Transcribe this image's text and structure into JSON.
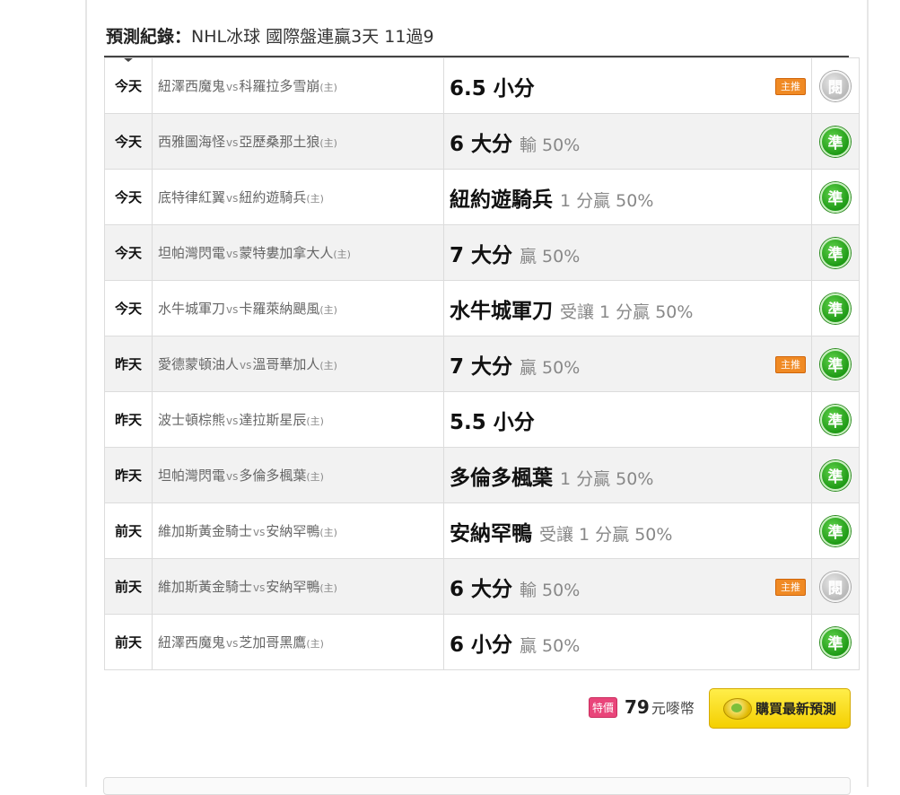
{
  "header": {
    "label": "預測紀錄：",
    "text": "NHL冰球 國際盤連贏3天 11過9"
  },
  "icons": {
    "result_win": "check-correct-icon",
    "result_none": "unevaluated-icon",
    "main_pick": "main-pick-badge",
    "coin": "coin-icon"
  },
  "colors": {
    "win_green": "#1f9a16",
    "none_gray": "#b9b9b9",
    "badge_orange": "#f08a24",
    "button_yellow": "#f4cf00",
    "sale_pink": "#e9457a"
  },
  "rows": [
    {
      "day": "今天",
      "away": "紐澤西魔鬼",
      "vs": "vs",
      "home": "科羅拉多雪崩",
      "home_tag": "(主)",
      "pick": "6.5 小分",
      "detail": "",
      "main_badge": "主推",
      "result": "閱",
      "result_type": "none"
    },
    {
      "day": "今天",
      "away": "西雅圖海怪",
      "vs": "vs",
      "home": "亞歷桑那土狼",
      "home_tag": "(主)",
      "pick": "6 大分",
      "detail": "輸 50%",
      "main_badge": "",
      "result": "準",
      "result_type": "win"
    },
    {
      "day": "今天",
      "away": "底特律紅翼",
      "vs": "vs",
      "home": "紐約遊騎兵",
      "home_tag": "(主)",
      "pick": "紐約遊騎兵",
      "detail": "1 分贏 50%",
      "main_badge": "",
      "result": "準",
      "result_type": "win"
    },
    {
      "day": "今天",
      "away": "坦帕灣閃電",
      "vs": "vs",
      "home": "蒙特婁加拿大人",
      "home_tag": "(主)",
      "pick": "7 大分",
      "detail": "贏 50%",
      "main_badge": "",
      "result": "準",
      "result_type": "win"
    },
    {
      "day": "今天",
      "away": "水牛城軍刀",
      "vs": "vs",
      "home": "卡羅萊納颶風",
      "home_tag": "(主)",
      "pick": "水牛城軍刀",
      "detail": "受讓 1 分贏 50%",
      "main_badge": "",
      "result": "準",
      "result_type": "win"
    },
    {
      "day": "昨天",
      "away": "愛德蒙頓油人",
      "vs": "vs",
      "home": "溫哥華加人",
      "home_tag": "(主)",
      "pick": "7 大分",
      "detail": "贏 50%",
      "main_badge": "主推",
      "result": "準",
      "result_type": "win"
    },
    {
      "day": "昨天",
      "away": "波士頓棕熊",
      "vs": "vs",
      "home": "達拉斯星辰",
      "home_tag": "(主)",
      "pick": "5.5 小分",
      "detail": "",
      "main_badge": "",
      "result": "準",
      "result_type": "win"
    },
    {
      "day": "昨天",
      "away": "坦帕灣閃電",
      "vs": "vs",
      "home": "多倫多楓葉",
      "home_tag": "(主)",
      "pick": "多倫多楓葉",
      "detail": "1 分贏 50%",
      "main_badge": "",
      "result": "準",
      "result_type": "win"
    },
    {
      "day": "前天",
      "away": "維加斯黃金騎士",
      "vs": "vs",
      "home": "安納罕鴨",
      "home_tag": "(主)",
      "pick": "安納罕鴨",
      "detail": "受讓 1 分贏 50%",
      "main_badge": "",
      "result": "準",
      "result_type": "win"
    },
    {
      "day": "前天",
      "away": "維加斯黃金騎士",
      "vs": "vs",
      "home": "安納罕鴨",
      "home_tag": "(主)",
      "pick": "6 大分",
      "detail": "輸 50%",
      "main_badge": "主推",
      "result": "閱",
      "result_type": "none"
    },
    {
      "day": "前天",
      "away": "紐澤西魔鬼",
      "vs": "vs",
      "home": "芝加哥黑鷹",
      "home_tag": "(主)",
      "pick": "6 小分",
      "detail": "贏 50%",
      "main_badge": "",
      "result": "準",
      "result_type": "win"
    }
  ],
  "footer": {
    "sale_tag": "特價",
    "price": "79",
    "unit": "元嘜幣",
    "buy_label": "購買最新預測"
  }
}
